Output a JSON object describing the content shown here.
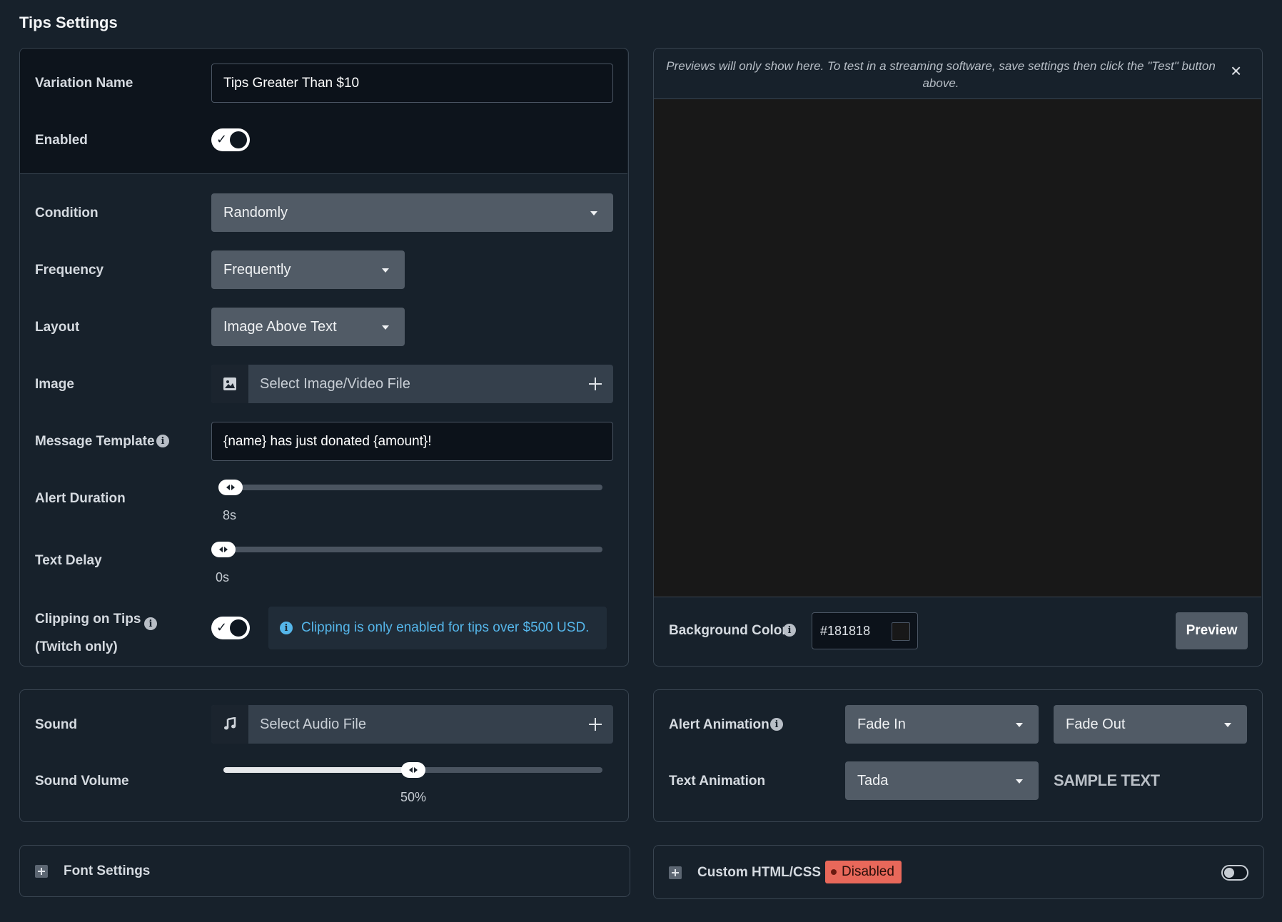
{
  "page": {
    "title": "Tips Settings"
  },
  "variation": {
    "name_label": "Variation Name",
    "name_value": "Tips Greater Than  $10",
    "enabled_label": "Enabled",
    "enabled": true
  },
  "settings": {
    "condition_label": "Condition",
    "condition_value": "Randomly",
    "frequency_label": "Frequency",
    "frequency_value": "Frequently",
    "layout_label": "Layout",
    "layout_value": "Image Above Text",
    "image_label": "Image",
    "image_placeholder": "Select Image/Video File",
    "message_label": "Message Template",
    "message_value": "{name} has just donated {amount}!",
    "alert_duration_label": "Alert Duration",
    "alert_duration_value": "8s",
    "text_delay_label": "Text Delay",
    "text_delay_value": "0s",
    "clipping_label_line1": "Clipping on Tips",
    "clipping_label_line2": "(Twitch only)",
    "clipping_enabled": true,
    "clipping_notice": "Clipping is only enabled for tips over $500 USD."
  },
  "preview": {
    "notice": "Previews will only show here. To test in a streaming software, save settings then click the \"Test\" button above.",
    "close_icon": "×",
    "bg_color_label": "Background Color",
    "bg_color_value": "#181818",
    "preview_button": "Preview"
  },
  "sound": {
    "sound_label": "Sound",
    "sound_placeholder": "Select Audio File",
    "volume_label": "Sound Volume",
    "volume_value": "50%",
    "volume_fraction": 0.5
  },
  "animation": {
    "alert_label": "Alert Animation",
    "alert_in": "Fade In",
    "alert_out": "Fade Out",
    "text_label": "Text Animation",
    "text_value": "Tada",
    "sample_text": "SAMPLE TEXT"
  },
  "font_settings": {
    "label": "Font Settings"
  },
  "custom_html": {
    "label": "Custom HTML/CSS",
    "badge": "Disabled",
    "badge_color": "#e8685a",
    "enabled": false
  }
}
